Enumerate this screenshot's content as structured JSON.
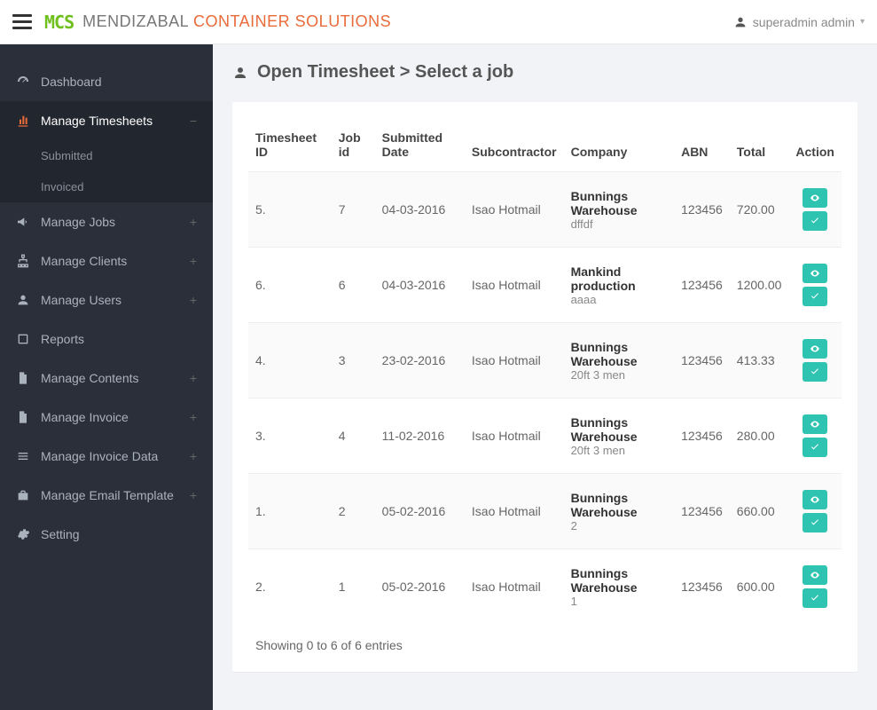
{
  "brand": {
    "logo": "MCS",
    "word1": "MENDIZABAL",
    "word2": "CONTAINER SOLUTIONS"
  },
  "user": {
    "name": "superadmin admin"
  },
  "sidebar": {
    "items": [
      {
        "label": "Dashboard",
        "icon": "dashboard",
        "expander": ""
      },
      {
        "label": "Manage Timesheets",
        "icon": "chart",
        "expander": "−",
        "active": true,
        "children": [
          {
            "label": "Submitted"
          },
          {
            "label": "Invoiced"
          }
        ]
      },
      {
        "label": "Manage Jobs",
        "icon": "megaphone",
        "expander": "+"
      },
      {
        "label": "Manage Clients",
        "icon": "sitemap",
        "expander": "+"
      },
      {
        "label": "Manage Users",
        "icon": "user",
        "expander": "+"
      },
      {
        "label": "Reports",
        "icon": "book",
        "expander": ""
      },
      {
        "label": "Manage Contents",
        "icon": "file",
        "expander": "+"
      },
      {
        "label": "Manage Invoice",
        "icon": "file",
        "expander": "+"
      },
      {
        "label": "Manage Invoice Data",
        "icon": "list",
        "expander": "+"
      },
      {
        "label": "Manage Email Template",
        "icon": "briefcase",
        "expander": "+"
      },
      {
        "label": "Setting",
        "icon": "gear",
        "expander": ""
      }
    ]
  },
  "page": {
    "title_prefix": "Open Timesheet",
    "title_sep": ">",
    "title_suffix": "Select a job"
  },
  "table": {
    "headers": {
      "timesheet_id": "Timesheet ID",
      "job_id": "Job id",
      "submitted": "Submitted Date",
      "subcontractor": "Subcontractor",
      "company": "Company",
      "abn": "ABN",
      "total": "Total",
      "action": "Action"
    },
    "rows": [
      {
        "id": "5.",
        "job": "7",
        "date": "04-03-2016",
        "sub": "Isao Hotmail",
        "company": "Bunnings Warehouse",
        "company_sub": "dffdf",
        "abn": "123456",
        "total": "720.00"
      },
      {
        "id": "6.",
        "job": "6",
        "date": "04-03-2016",
        "sub": "Isao Hotmail",
        "company": "Mankind production",
        "company_sub": "aaaa",
        "abn": "123456",
        "total": "1200.00"
      },
      {
        "id": "4.",
        "job": "3",
        "date": "23-02-2016",
        "sub": "Isao Hotmail",
        "company": "Bunnings Warehouse",
        "company_sub": "20ft 3 men",
        "abn": "123456",
        "total": "413.33"
      },
      {
        "id": "3.",
        "job": "4",
        "date": "11-02-2016",
        "sub": "Isao Hotmail",
        "company": "Bunnings Warehouse",
        "company_sub": "20ft 3 men",
        "abn": "123456",
        "total": "280.00"
      },
      {
        "id": "1.",
        "job": "2",
        "date": "05-02-2016",
        "sub": "Isao Hotmail",
        "company": "Bunnings Warehouse",
        "company_sub": "2",
        "abn": "123456",
        "total": "660.00"
      },
      {
        "id": "2.",
        "job": "1",
        "date": "05-02-2016",
        "sub": "Isao Hotmail",
        "company": "Bunnings Warehouse",
        "company_sub": "1",
        "abn": "123456",
        "total": "600.00"
      }
    ],
    "info": "Showing 0 to 6 of 6 entries"
  }
}
